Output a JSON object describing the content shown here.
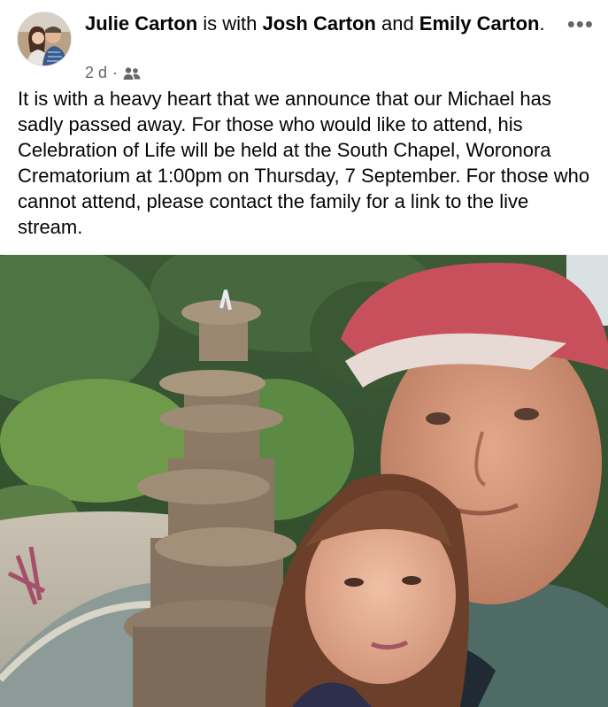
{
  "post": {
    "author": "Julie Carton",
    "with_text": " is with ",
    "tagged_1": "Josh Carton",
    "and_text": " and ",
    "tagged_2": "Emily Carton",
    "period": ".",
    "time": "2 d",
    "separator": "·",
    "audience_icon": "friends-icon",
    "more_icon": "more-options-icon",
    "more_glyph": "•••",
    "body": "It is with a heavy heart that we announce that our Michael has sadly passed away. For those who would like to attend, his Celebration of Life will be held at the South Chapel, Woronora Crematorium at 1:00pm on Thursday, 7 September. For those who cannot attend, please contact the family for a link to the live stream."
  },
  "colors": {
    "text": "#050505",
    "meta": "#65676b",
    "background": "#ffffff"
  }
}
